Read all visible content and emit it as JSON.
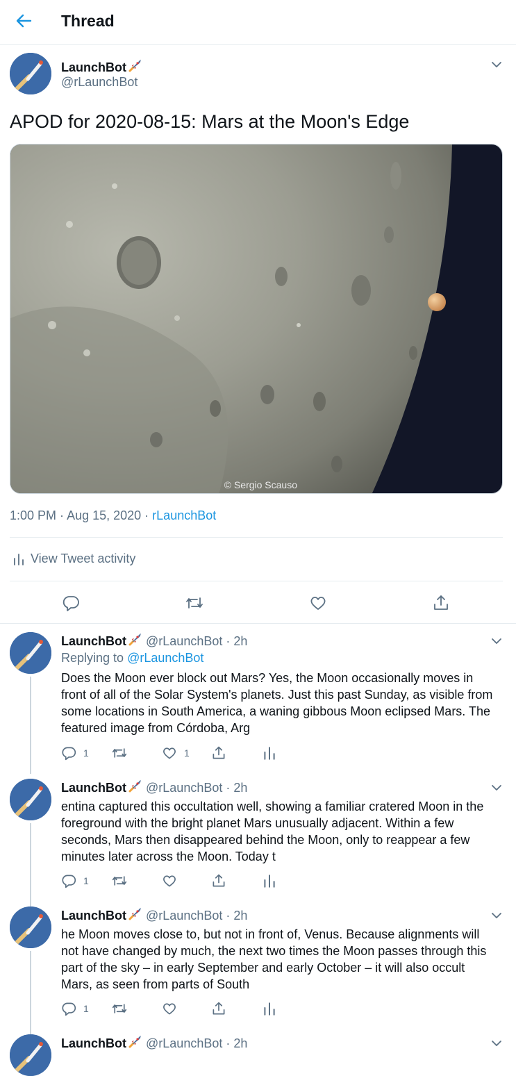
{
  "header": {
    "title": "Thread"
  },
  "main_tweet": {
    "name": "LaunchBot",
    "handle": "@rLaunchBot",
    "text": "APOD for 2020-08-15: Mars at the Moon's Edge",
    "image_credit": "© Sergio Scauso",
    "time": "1:00 PM",
    "date": "Aug 15, 2020",
    "source": "rLaunchBot",
    "view_activity": "View Tweet activity"
  },
  "replies": [
    {
      "name": "LaunchBot",
      "handle": "@rLaunchBot",
      "age": "2h",
      "replying_prefix": "Replying to",
      "replying_to": "@rLaunchBot",
      "text": "Does the Moon ever block out Mars? Yes, the Moon occasionally moves in front of all of the Solar System's planets.  Just this past Sunday, as visible from some locations in South America, a waning gibbous Moon eclipsed Mars.  The featured image from Córdoba, Arg",
      "reply_count": "1",
      "like_count": "1"
    },
    {
      "name": "LaunchBot",
      "handle": "@rLaunchBot",
      "age": "2h",
      "text": "entina captured this occultation well, showing a familiar cratered Moon in the foreground with the bright planet Mars unusually adjacent.  Within a few seconds, Mars then disappeared behind the Moon, only to reappear a few minutes later across the Moon.  Today t",
      "reply_count": "1"
    },
    {
      "name": "LaunchBot",
      "handle": "@rLaunchBot",
      "age": "2h",
      "text": "he Moon moves close to, but not in front of, Venus.  Because alignments will not have changed by much, the next two times the Moon passes through this part of the sky – in early September and early October – it will also occult Mars, as seen from parts of South",
      "reply_count": "1"
    },
    {
      "name": "LaunchBot",
      "handle": "@rLaunchBot",
      "age": "2h"
    }
  ],
  "colors": {
    "accent": "#1b95e0",
    "muted": "#5b7083",
    "border": "#e6ecf0"
  },
  "icons": [
    "back-arrow-icon",
    "chevron-down-icon",
    "rocket-emoji-icon",
    "reply-icon",
    "retweet-icon",
    "like-icon",
    "share-icon",
    "analytics-icon"
  ]
}
